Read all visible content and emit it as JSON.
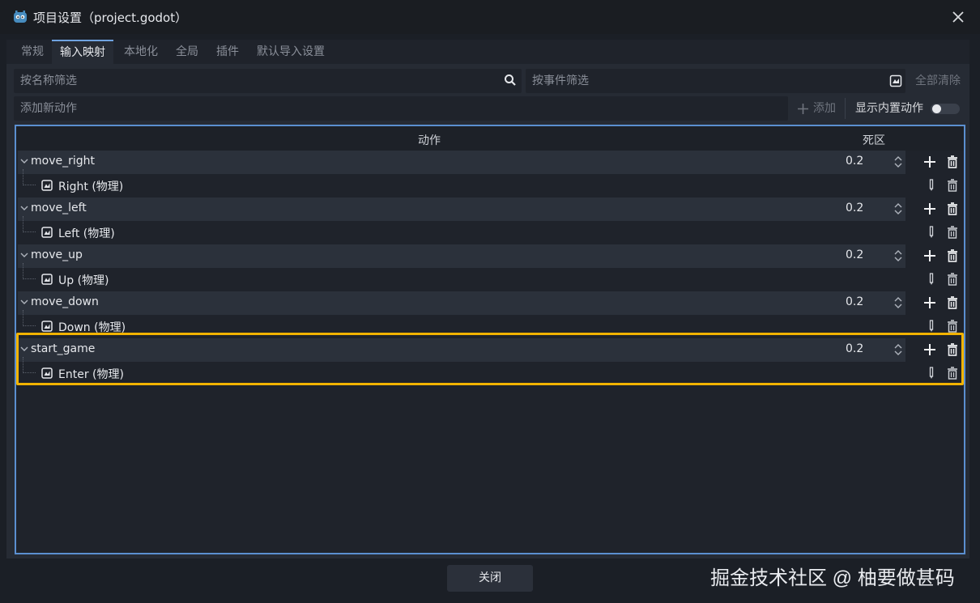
{
  "window": {
    "title": "项目设置（project.godot）"
  },
  "tabs": [
    "常规",
    "输入映射",
    "本地化",
    "全局",
    "插件",
    "默认导入设置"
  ],
  "filters": {
    "name_placeholder": "按名称筛选",
    "event_placeholder": "按事件筛选",
    "clear_all_label": "全部清除"
  },
  "add_action": {
    "placeholder": "添加新动作",
    "add_label": "添加",
    "show_builtin_label": "显示内置动作"
  },
  "table": {
    "col_action": "动作",
    "col_deadzone": "死区",
    "rows": [
      {
        "action": "move_right",
        "deadzone": "0.2",
        "event": "Right (物理)"
      },
      {
        "action": "move_left",
        "deadzone": "0.2",
        "event": "Left (物理)"
      },
      {
        "action": "move_up",
        "deadzone": "0.2",
        "event": "Up (物理)"
      },
      {
        "action": "move_down",
        "deadzone": "0.2",
        "event": "Down (物理)"
      },
      {
        "action": "start_game",
        "deadzone": "0.2",
        "event": "Enter (物理)"
      }
    ]
  },
  "footer": {
    "close_label": "关闭"
  },
  "watermark": "掘金技术社区 @ 柚要做甚码",
  "colors": {
    "accent": "#5b8fd0",
    "highlight": "#f2b300"
  }
}
